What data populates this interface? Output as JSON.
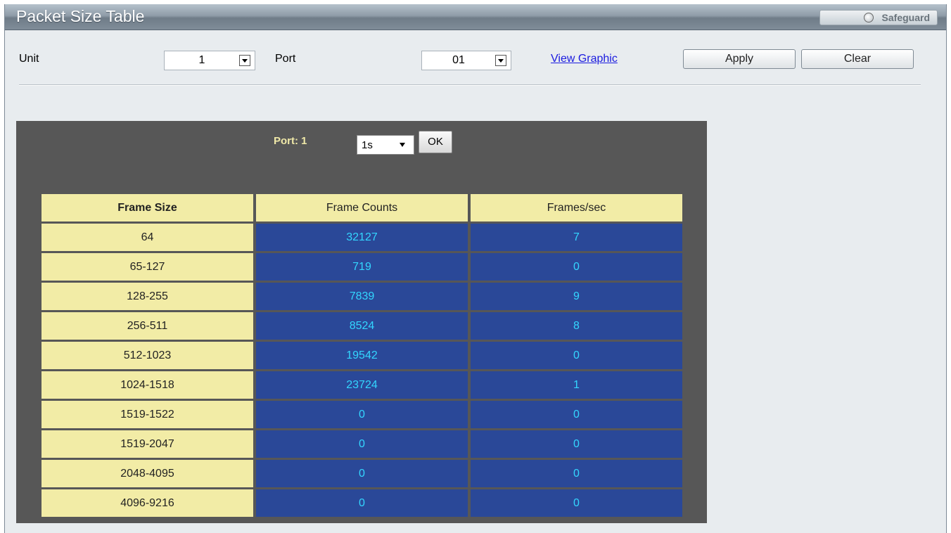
{
  "window": {
    "title": "Packet Size Table",
    "safeguard_label": "Safeguard"
  },
  "toolbar": {
    "unit_label": "Unit",
    "unit_value": "1",
    "port_label": "Port",
    "port_value": "01",
    "view_graphic_link": "View Graphic",
    "apply_label": "Apply",
    "clear_label": "Clear"
  },
  "panel": {
    "port_label": "Port: 1",
    "interval_value": "1s",
    "ok_label": "OK"
  },
  "table": {
    "headers": [
      "Frame Size",
      "Frame Counts",
      "Frames/sec"
    ],
    "rows": [
      [
        "64",
        "32127",
        "7"
      ],
      [
        "65-127",
        "719",
        "0"
      ],
      [
        "128-255",
        "7839",
        "9"
      ],
      [
        "256-511",
        "8524",
        "8"
      ],
      [
        "512-1023",
        "19542",
        "0"
      ],
      [
        "1024-1518",
        "23724",
        "1"
      ],
      [
        "1519-1522",
        "0",
        "0"
      ],
      [
        "1519-2047",
        "0",
        "0"
      ],
      [
        "2048-4095",
        "0",
        "0"
      ],
      [
        "4096-9216",
        "0",
        "0"
      ]
    ]
  },
  "colors": {
    "header_bg": "#f2eca6",
    "value_bg": "#2a4898",
    "value_text": "#33d6ff",
    "panel_bg": "#575757"
  }
}
